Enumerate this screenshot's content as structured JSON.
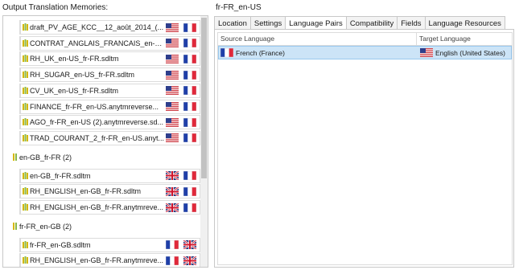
{
  "left_title": "Output Translation Memories:",
  "right_title": "fr-FR_en-US",
  "groups": [
    {
      "label": "",
      "items": [
        {
          "name": "draft_PV_AGE_KCC__12_août_2014_(...",
          "src": "us",
          "tgt": "fr"
        },
        {
          "name": "CONTRAT_ANGLAIS_FRANCAIS_en-U...",
          "src": "us",
          "tgt": "fr"
        },
        {
          "name": "RH_UK_en-US_fr-FR.sdltm",
          "src": "us",
          "tgt": "fr"
        },
        {
          "name": "RH_SUGAR_en-US_fr-FR.sdltm",
          "src": "us",
          "tgt": "fr"
        },
        {
          "name": "CV_UK_en-US_fr-FR.sdltm",
          "src": "us",
          "tgt": "fr"
        },
        {
          "name": "FINANCE_fr-FR_en-US.anytmreverse...",
          "src": "us",
          "tgt": "fr"
        },
        {
          "name": "AGO_fr-FR_en-US (2).anytmreverse.sd...",
          "src": "us",
          "tgt": "fr"
        },
        {
          "name": "TRAD_COURANT_2_fr-FR_en-US.anyt...",
          "src": "us",
          "tgt": "fr"
        }
      ]
    },
    {
      "label": "en-GB_fr-FR (2)",
      "items": [
        {
          "name": "en-GB_fr-FR.sdltm",
          "src": "gb",
          "tgt": "fr"
        },
        {
          "name": "RH_ENGLISH_en-GB_fr-FR.sdltm",
          "src": "gb",
          "tgt": "fr"
        },
        {
          "name": "RH_ENGLISH_en-GB_fr-FR.anytmreve...",
          "src": "gb",
          "tgt": "fr"
        }
      ]
    },
    {
      "label": "fr-FR_en-GB (2)",
      "items": [
        {
          "name": "fr-FR_en-GB.sdltm",
          "src": "fr",
          "tgt": "gb"
        },
        {
          "name": "RH_ENGLISH_en-GB_fr-FR.anytmreve...",
          "src": "fr",
          "tgt": "gb"
        }
      ]
    }
  ],
  "tabs": [
    "Location",
    "Settings",
    "Language Pairs",
    "Compatibility",
    "Fields",
    "Language Resources"
  ],
  "active_tab": "Language Pairs",
  "grid": {
    "col_source": "Source Language",
    "col_target": "Target Language",
    "rows": [
      {
        "source": "French (France)",
        "source_flag": "fr",
        "target": "English (United States)",
        "target_flag": "us"
      }
    ]
  },
  "colors": {
    "selection": "#cce4f7",
    "tm_icon": "#c8b400"
  }
}
